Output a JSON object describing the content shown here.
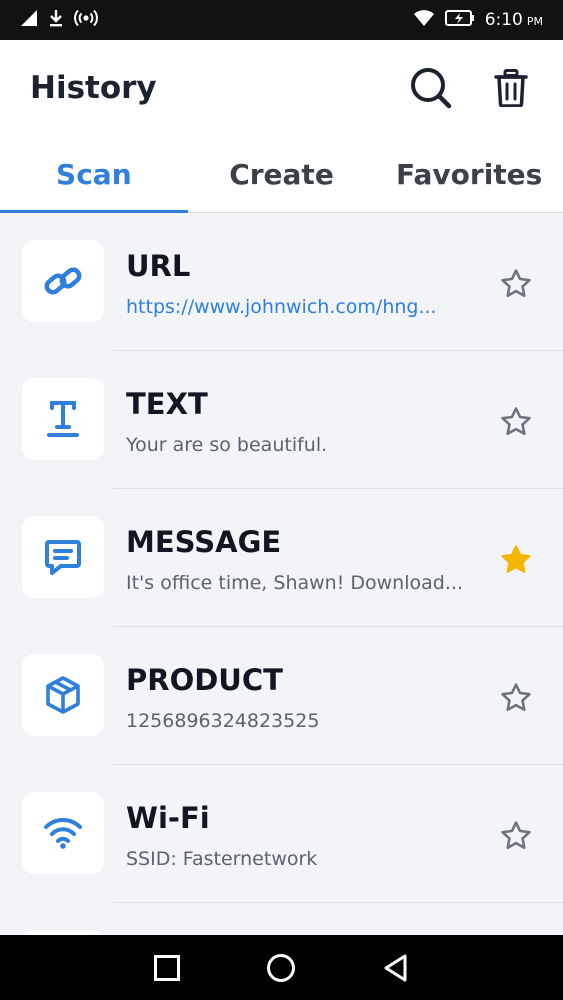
{
  "status_bar": {
    "time": "6:10",
    "ampm": "PM",
    "icons": [
      "signal-icon",
      "download-icon",
      "hotspot-icon",
      "wifi-icon",
      "battery-charging-icon"
    ]
  },
  "header": {
    "title": "History",
    "icons": [
      "search-icon",
      "trash-icon"
    ]
  },
  "tabs": [
    {
      "label": "Scan",
      "active": true
    },
    {
      "label": "Create",
      "active": false
    },
    {
      "label": "Favorites",
      "active": false
    }
  ],
  "items": [
    {
      "title": "URL",
      "subtitle": "https://www.johnwich.com/hng...",
      "icon": "link-icon",
      "favorite": false,
      "is_link": true
    },
    {
      "title": "TEXT",
      "subtitle": "Your are so beautiful.",
      "icon": "text-icon",
      "favorite": false,
      "is_link": false
    },
    {
      "title": "MESSAGE",
      "subtitle": "It's office time, Shawn! Download...",
      "icon": "message-icon",
      "favorite": true,
      "is_link": false
    },
    {
      "title": "PRODUCT",
      "subtitle": "1256896324823525",
      "icon": "box-icon",
      "favorite": false,
      "is_link": false
    },
    {
      "title": "Wi-Fi",
      "subtitle": "SSID: Fasternetwork",
      "icon": "wifi-icon",
      "favorite": false,
      "is_link": false
    }
  ],
  "colors": {
    "accent": "#2f7fdc",
    "star_active": "#f7b500",
    "star_inactive": "#6b7280"
  },
  "nav_bar": {
    "icons": [
      "recents-square-icon",
      "home-circle-icon",
      "back-triangle-icon"
    ]
  }
}
